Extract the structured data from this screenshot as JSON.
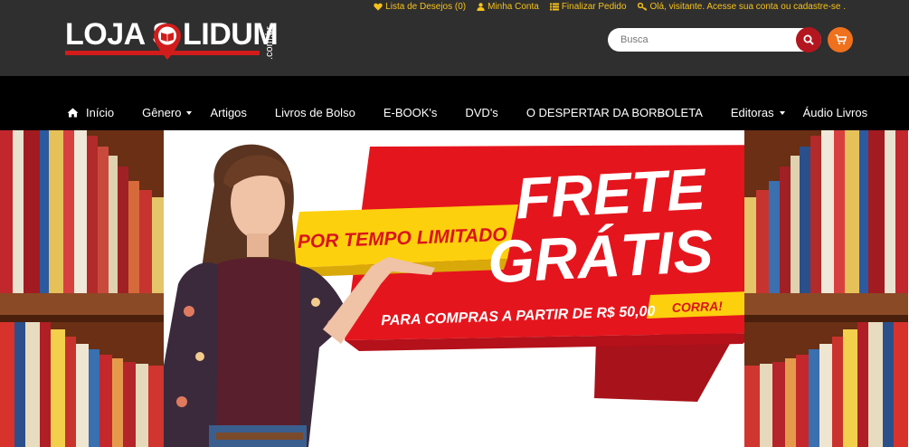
{
  "colors": {
    "header_bg": "#2f2f2f",
    "nav_bg": "#000000",
    "accent_gold": "#f6c21a",
    "search_button": "#b3161f",
    "cart_button": "#f0711d",
    "banner_red": "#e5151d",
    "banner_yellow": "#fcd00d"
  },
  "toplinks": [
    {
      "icon": "heart-icon",
      "label": "Lista de Desejos (0)"
    },
    {
      "icon": "user-icon",
      "label": "Minha Conta"
    },
    {
      "icon": "list-icon",
      "label": "Finalizar Pedido"
    }
  ],
  "login": {
    "icon": "key-icon",
    "greeting": "Olá, visitante. Acesse sua conta",
    "register": "ou cadastre-se ."
  },
  "logo": {
    "word_a": "LOJA S",
    "word_b": "LIDUM",
    "suffix": ".com.br"
  },
  "search": {
    "placeholder": "Busca",
    "button_icon": "search-icon"
  },
  "cart": {
    "icon": "cart-icon"
  },
  "nav": [
    {
      "label": "Início",
      "icon": "home-icon",
      "dropdown": false
    },
    {
      "label": "Gênero",
      "dropdown": true
    },
    {
      "label": "Artigos",
      "dropdown": false
    },
    {
      "label": "Livros de Bolso",
      "dropdown": false
    },
    {
      "label": "E-BOOK's",
      "dropdown": false
    },
    {
      "label": "DVD's",
      "dropdown": false
    },
    {
      "label": "O DESPERTAR DA BORBOLETA",
      "dropdown": false
    },
    {
      "label": "Editoras",
      "dropdown": true
    },
    {
      "label": "Áudio Livros",
      "dropdown": false
    }
  ],
  "banner": {
    "tag": "POR TEMPO LIMITADO",
    "headline_1": "FRETE",
    "headline_2": "GRÁTIS",
    "subline": "PARA COMPRAS A PARTIR DE R$ 50,00",
    "cta": "CORRA!"
  }
}
